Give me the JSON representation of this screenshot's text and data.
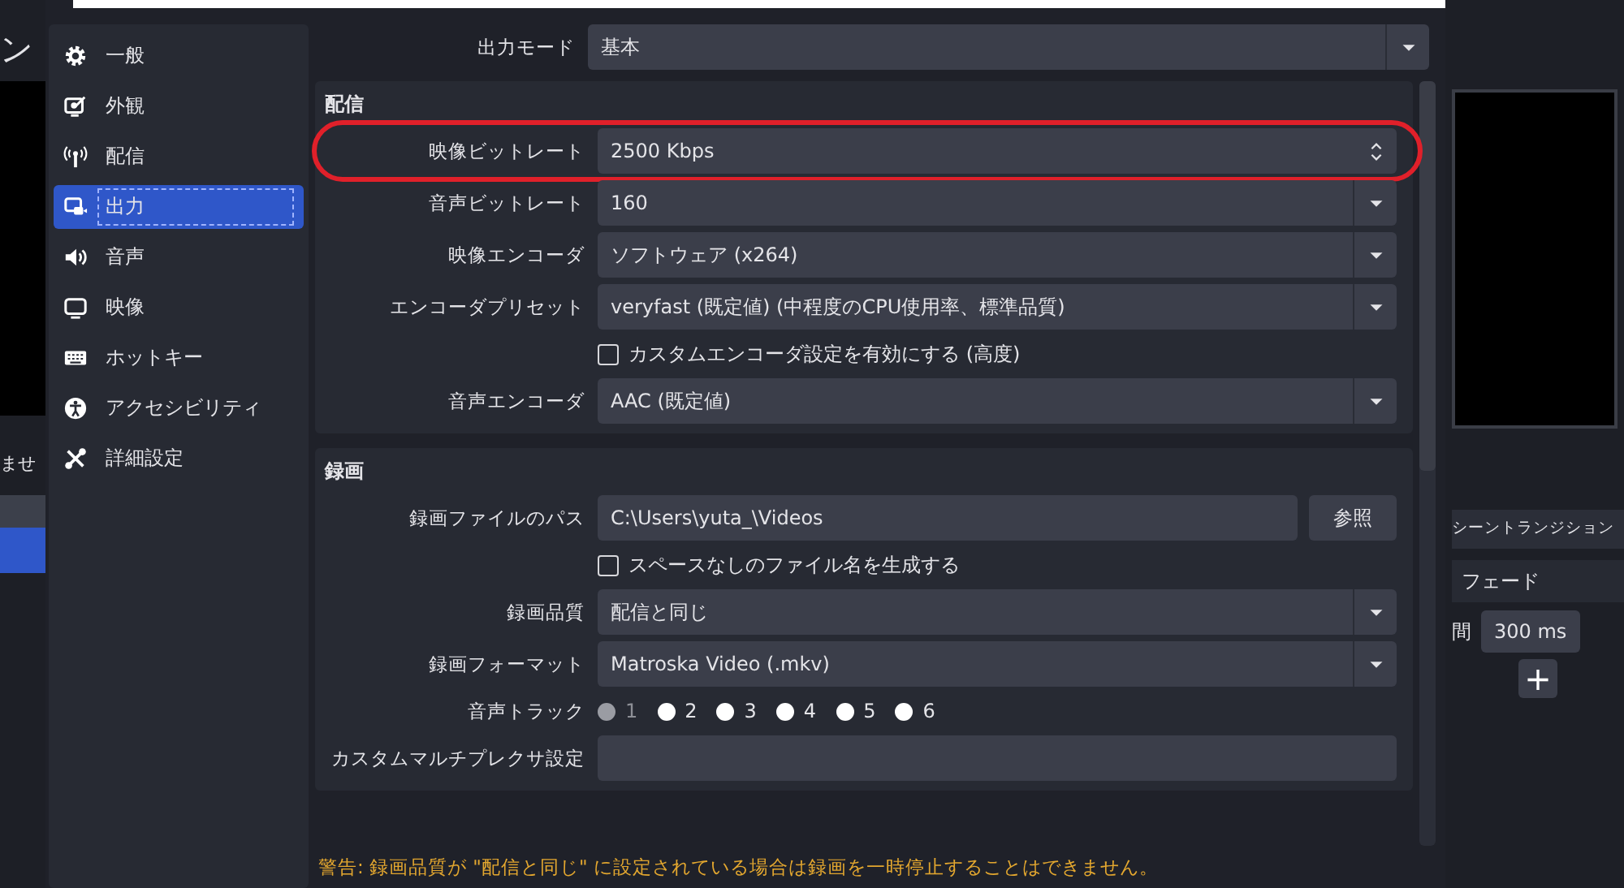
{
  "background_window": {
    "left_header": "ン",
    "left_list_text": "ませ",
    "transition_header": "シーントランジション",
    "transition": "フェード",
    "duration_label": "間",
    "duration": "300 ms",
    "add_button": "+"
  },
  "sidebar": {
    "items": [
      {
        "label": "一般",
        "selected": false
      },
      {
        "label": "外観",
        "selected": false
      },
      {
        "label": "配信",
        "selected": false
      },
      {
        "label": "出力",
        "selected": true
      },
      {
        "label": "音声",
        "selected": false
      },
      {
        "label": "映像",
        "selected": false
      },
      {
        "label": "ホットキー",
        "selected": false
      },
      {
        "label": "アクセシビリティ",
        "selected": false
      },
      {
        "label": "詳細設定",
        "selected": false
      }
    ]
  },
  "output_mode": {
    "label": "出力モード",
    "value": "基本"
  },
  "sections": [
    {
      "title": "配信",
      "rows": [
        {
          "kind": "spin",
          "label": "映像ビットレート",
          "value": "2500 Kbps",
          "highlighted": true
        },
        {
          "kind": "select",
          "label": "音声ビットレート",
          "value": "160",
          "highlighted": false
        },
        {
          "kind": "select",
          "label": "映像エンコーダ",
          "value": "ソフトウェア (x264)",
          "highlighted": false
        },
        {
          "kind": "select",
          "label": "エンコーダプリセット",
          "value": "veryfast (既定値) (中程度のCPU使用率、標準品質)",
          "highlighted": false
        },
        {
          "kind": "checkbox",
          "label": "カスタムエンコーダ設定を有効にする (高度)",
          "checked": false,
          "highlighted": false
        },
        {
          "kind": "select",
          "label": "音声エンコーダ",
          "value": "AAC (既定値)",
          "highlighted": false
        }
      ]
    },
    {
      "title": "録画",
      "rows": [
        {
          "kind": "path",
          "label": "録画ファイルのパス",
          "value": "C:\\Users\\yuta_\\Videos",
          "button": "参照",
          "highlighted": false
        },
        {
          "kind": "checkbox",
          "label": "スペースなしのファイル名を生成する",
          "checked": false,
          "highlighted": false
        },
        {
          "kind": "select",
          "label": "録画品質",
          "value": "配信と同じ",
          "highlighted": false
        },
        {
          "kind": "select",
          "label": "録画フォーマット",
          "value": "Matroska Video (.mkv)",
          "highlighted": false
        },
        {
          "kind": "tracks",
          "label": "音声トラック",
          "highlighted": false,
          "tracks": [
            {
              "label": "1",
              "disabled": true
            },
            {
              "label": "2",
              "disabled": false
            },
            {
              "label": "3",
              "disabled": false
            },
            {
              "label": "4",
              "disabled": false
            },
            {
              "label": "5",
              "disabled": false
            },
            {
              "label": "6",
              "disabled": false
            }
          ]
        },
        {
          "kind": "text",
          "label": "カスタムマルチプレクサ設定",
          "highlighted": false
        }
      ]
    }
  ],
  "warning": "警告: 録画品質が \"配信と同じ\" に設定されている場合は録画を一時停止することはできません。"
}
